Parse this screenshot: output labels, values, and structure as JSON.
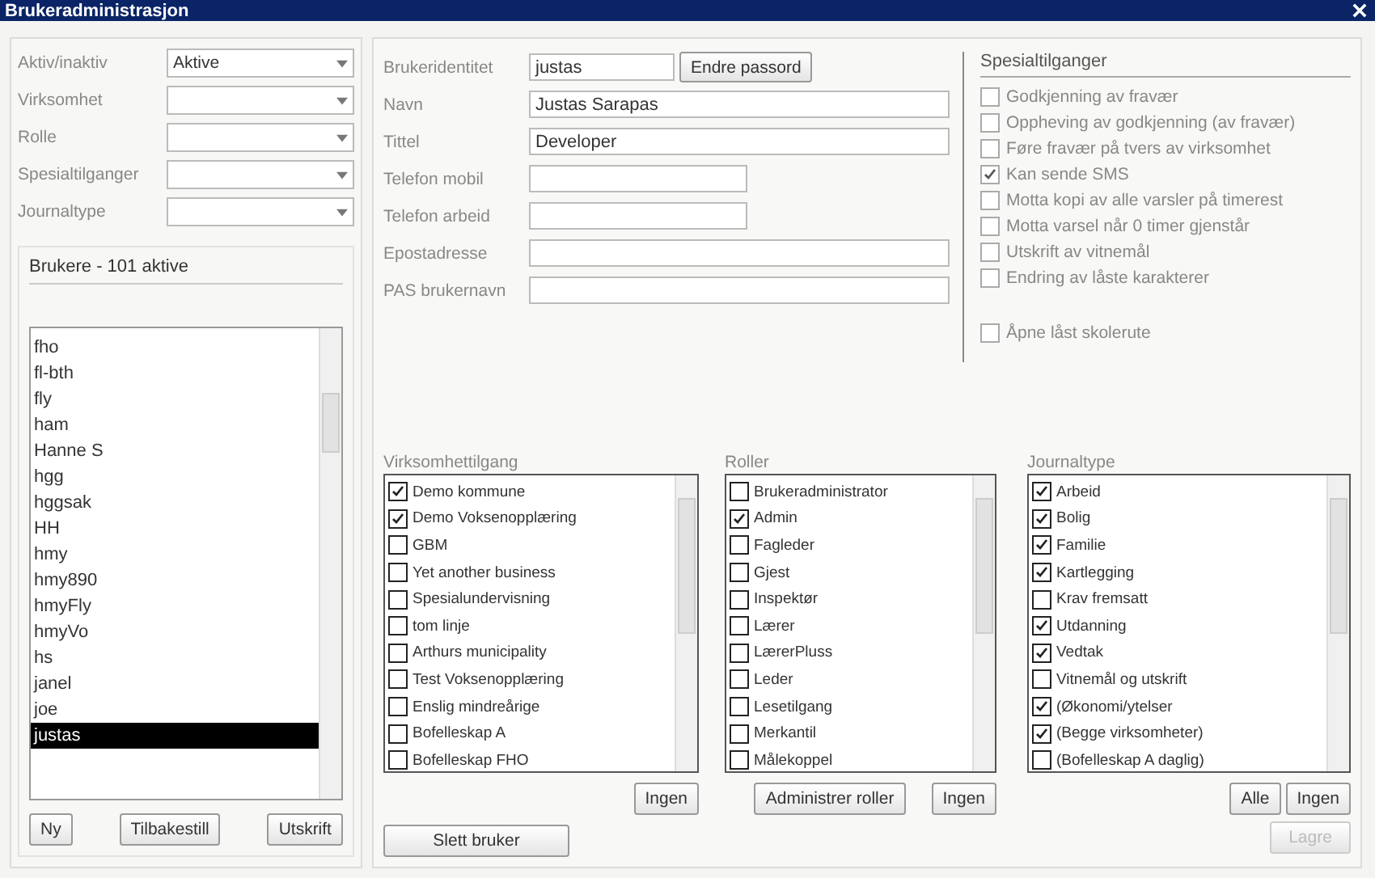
{
  "window": {
    "title": "Brukeradministrasjon"
  },
  "filters": [
    {
      "label": "Aktiv/inaktiv",
      "value": "Aktive"
    },
    {
      "label": "Virksomhet"
    },
    {
      "label": "Rolle"
    },
    {
      "label": "Spesialtilganger"
    },
    {
      "label": "Journaltype"
    }
  ],
  "users": {
    "heading": "Brukere - 101 aktive",
    "items": [
      {
        "name": "fho",
        "selected": false
      },
      {
        "name": "fl-bth",
        "selected": false
      },
      {
        "name": "fly",
        "selected": false
      },
      {
        "name": "ham",
        "selected": false
      },
      {
        "name": "Hanne S",
        "selected": false
      },
      {
        "name": "hgg",
        "selected": false
      },
      {
        "name": "hggsak",
        "selected": false
      },
      {
        "name": "HH",
        "selected": false
      },
      {
        "name": "hmy",
        "selected": false
      },
      {
        "name": "hmy890",
        "selected": false
      },
      {
        "name": "hmyFly",
        "selected": false
      },
      {
        "name": "hmyVo",
        "selected": false
      },
      {
        "name": "hs",
        "selected": false
      },
      {
        "name": "janel",
        "selected": false
      },
      {
        "name": "joe",
        "selected": false
      },
      {
        "name": "justas",
        "selected": true
      }
    ]
  },
  "user_buttons": [
    "Ny",
    "Tilbakestill",
    "Utskrift"
  ],
  "form": {
    "fields": [
      {
        "label": "Brukeridentitet",
        "value": "justas",
        "kind": "id"
      },
      {
        "label": "Navn",
        "value": "Justas Sarapas",
        "kind": "long"
      },
      {
        "label": "Tittel",
        "value": "Developer",
        "kind": "long"
      },
      {
        "label": "Telefon mobil",
        "kind": "short"
      },
      {
        "label": "Telefon arbeid",
        "kind": "short"
      },
      {
        "label": "Epostadresse",
        "kind": "long"
      },
      {
        "label": "PAS brukernavn",
        "kind": "long"
      }
    ],
    "password_button": "Endre passord"
  },
  "special": {
    "heading": "Spesialtilganger",
    "items": [
      {
        "label": "Godkjenning av fravær",
        "checked": false
      },
      {
        "label": "Oppheving av godkjenning (av fravær)",
        "checked": false
      },
      {
        "label": "Føre fravær på tvers av virksomhet",
        "checked": false
      },
      {
        "label": "Kan sende SMS",
        "checked": true
      },
      {
        "label": "Motta kopi av alle varsler på timerest",
        "checked": false
      },
      {
        "label": "Motta varsel når 0 timer gjenstår",
        "checked": false
      },
      {
        "label": "Utskrift av vitnemål",
        "checked": false
      },
      {
        "label": "Endring av låste karakterer",
        "checked": false
      }
    ],
    "separate_item": {
      "label": "Åpne låst skolerute",
      "checked": false
    }
  },
  "lists": [
    {
      "title": "Virksomhettilgang",
      "items": [
        {
          "label": "Demo kommune",
          "checked": true
        },
        {
          "label": "Demo Voksenopplæring",
          "checked": true
        },
        {
          "label": "GBM",
          "checked": false
        },
        {
          "label": "Yet another business",
          "checked": false
        },
        {
          "label": "Spesialundervisning",
          "checked": false
        },
        {
          "label": "tom linje",
          "checked": false
        },
        {
          "label": "Arthurs municipality",
          "checked": false
        },
        {
          "label": "Test Voksenopplæring",
          "checked": false
        },
        {
          "label": "Enslig mindreårige",
          "checked": false
        },
        {
          "label": "Bofelleskap A",
          "checked": false
        },
        {
          "label": "Bofelleskap FHO",
          "checked": false
        }
      ],
      "buttons": [
        "Ingen"
      ]
    },
    {
      "title": "Roller",
      "items": [
        {
          "label": "Brukeradministrator",
          "checked": false
        },
        {
          "label": "Admin",
          "checked": true
        },
        {
          "label": "Fagleder",
          "checked": false
        },
        {
          "label": "Gjest",
          "checked": false
        },
        {
          "label": "Inspektør",
          "checked": false
        },
        {
          "label": "Lærer",
          "checked": false
        },
        {
          "label": "LærerPluss",
          "checked": false
        },
        {
          "label": "Leder",
          "checked": false
        },
        {
          "label": "Lesetilgang",
          "checked": false
        },
        {
          "label": "Merkantil",
          "checked": false
        },
        {
          "label": "Målekoppel",
          "checked": false
        }
      ],
      "buttons": [
        "Administrer roller",
        "Ingen"
      ]
    },
    {
      "title": "Journaltype",
      "items": [
        {
          "label": "Arbeid",
          "checked": true
        },
        {
          "label": "Bolig",
          "checked": true
        },
        {
          "label": "Familie",
          "checked": true
        },
        {
          "label": "Kartlegging",
          "checked": true
        },
        {
          "label": "Krav fremsatt",
          "checked": false
        },
        {
          "label": "Utdanning",
          "checked": true
        },
        {
          "label": "Vedtak",
          "checked": true
        },
        {
          "label": "Vitnemål og utskrift",
          "checked": false
        },
        {
          "label": "(Økonomi/ytelser",
          "checked": true
        },
        {
          "label": "(Begge virksomheter)",
          "checked": true
        },
        {
          "label": "(Bofelleskap A daglig)",
          "checked": false
        }
      ],
      "buttons": [
        "Alle",
        "Ingen"
      ]
    }
  ],
  "delete_button": "Slett bruker",
  "save_button": {
    "label": "Lagre",
    "disabled": true
  }
}
